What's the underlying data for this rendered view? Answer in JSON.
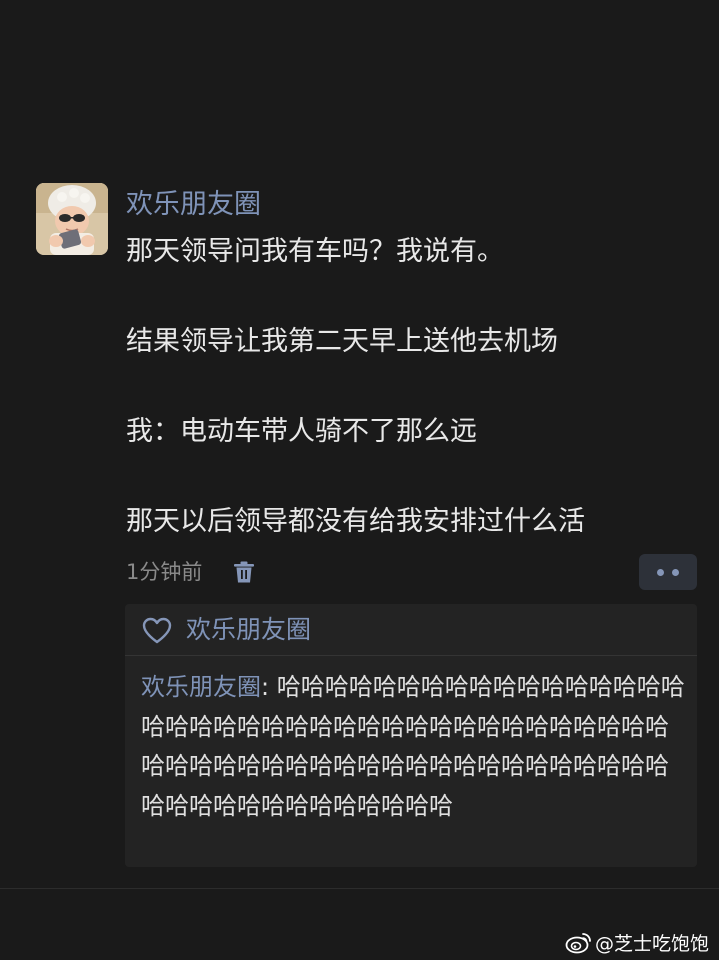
{
  "post": {
    "author": "欢乐朋友圈",
    "lines": [
      "那天领导问我有车吗？我说有。",
      "",
      "结果领导让我第二天早上送他去机场",
      "",
      "我：电动车带人骑不了那么远",
      "",
      "那天以后领导都没有给我安排过什么活"
    ],
    "time": "1分钟前",
    "icons": {
      "delete": "trash-icon",
      "more": "more-dots-icon"
    }
  },
  "likes": {
    "icon": "heart-outline-icon",
    "names": "欢乐朋友圈"
  },
  "comment": {
    "author": "欢乐朋友圈",
    "separator": ": ",
    "text": "哈哈哈哈哈哈哈哈哈哈哈哈哈哈哈哈哈哈哈哈哈哈哈哈哈哈哈哈哈哈哈哈哈哈哈哈哈哈哈哈哈哈哈哈哈哈哈哈哈哈哈哈哈哈哈哈哈哈哈哈哈哈哈哈哈哈哈哈哈哈哈哈哈哈"
  },
  "watermark": {
    "icon": "weibo-logo-icon",
    "text": "@芝士吃饱饱"
  },
  "colors": {
    "background": "#1a1a1a",
    "name_link": "#7f93b8",
    "panel": "#232323"
  }
}
